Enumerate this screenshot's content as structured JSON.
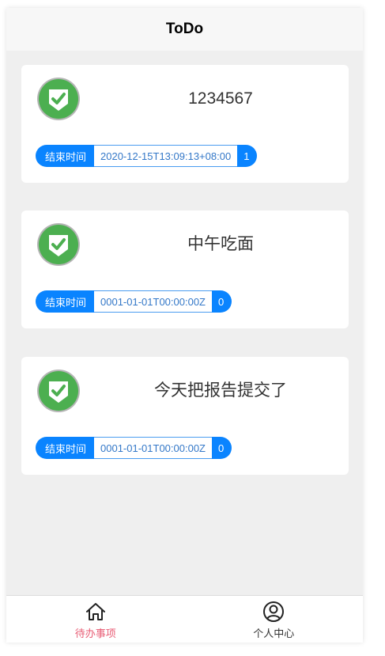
{
  "header": {
    "title": "ToDo"
  },
  "todos": [
    {
      "title": "1234567",
      "deadline_label": "结束时间",
      "deadline": "2020-12-15T13:09:13+08:00",
      "count": "1"
    },
    {
      "title": "中午吃面",
      "deadline_label": "结束时间",
      "deadline": "0001-01-01T00:00:00Z",
      "count": "0"
    },
    {
      "title": "今天把报告提交了",
      "deadline_label": "结束时间",
      "deadline": "0001-01-01T00:00:00Z",
      "count": "0"
    }
  ],
  "tabbar": {
    "items": [
      {
        "label": "待办事项",
        "icon": "home-icon",
        "active": true
      },
      {
        "label": "个人中心",
        "icon": "user-circle-icon",
        "active": false
      }
    ]
  },
  "colors": {
    "accent": "#0a84ff",
    "active_tab": "#e85d75",
    "check_green": "#4caf50"
  }
}
